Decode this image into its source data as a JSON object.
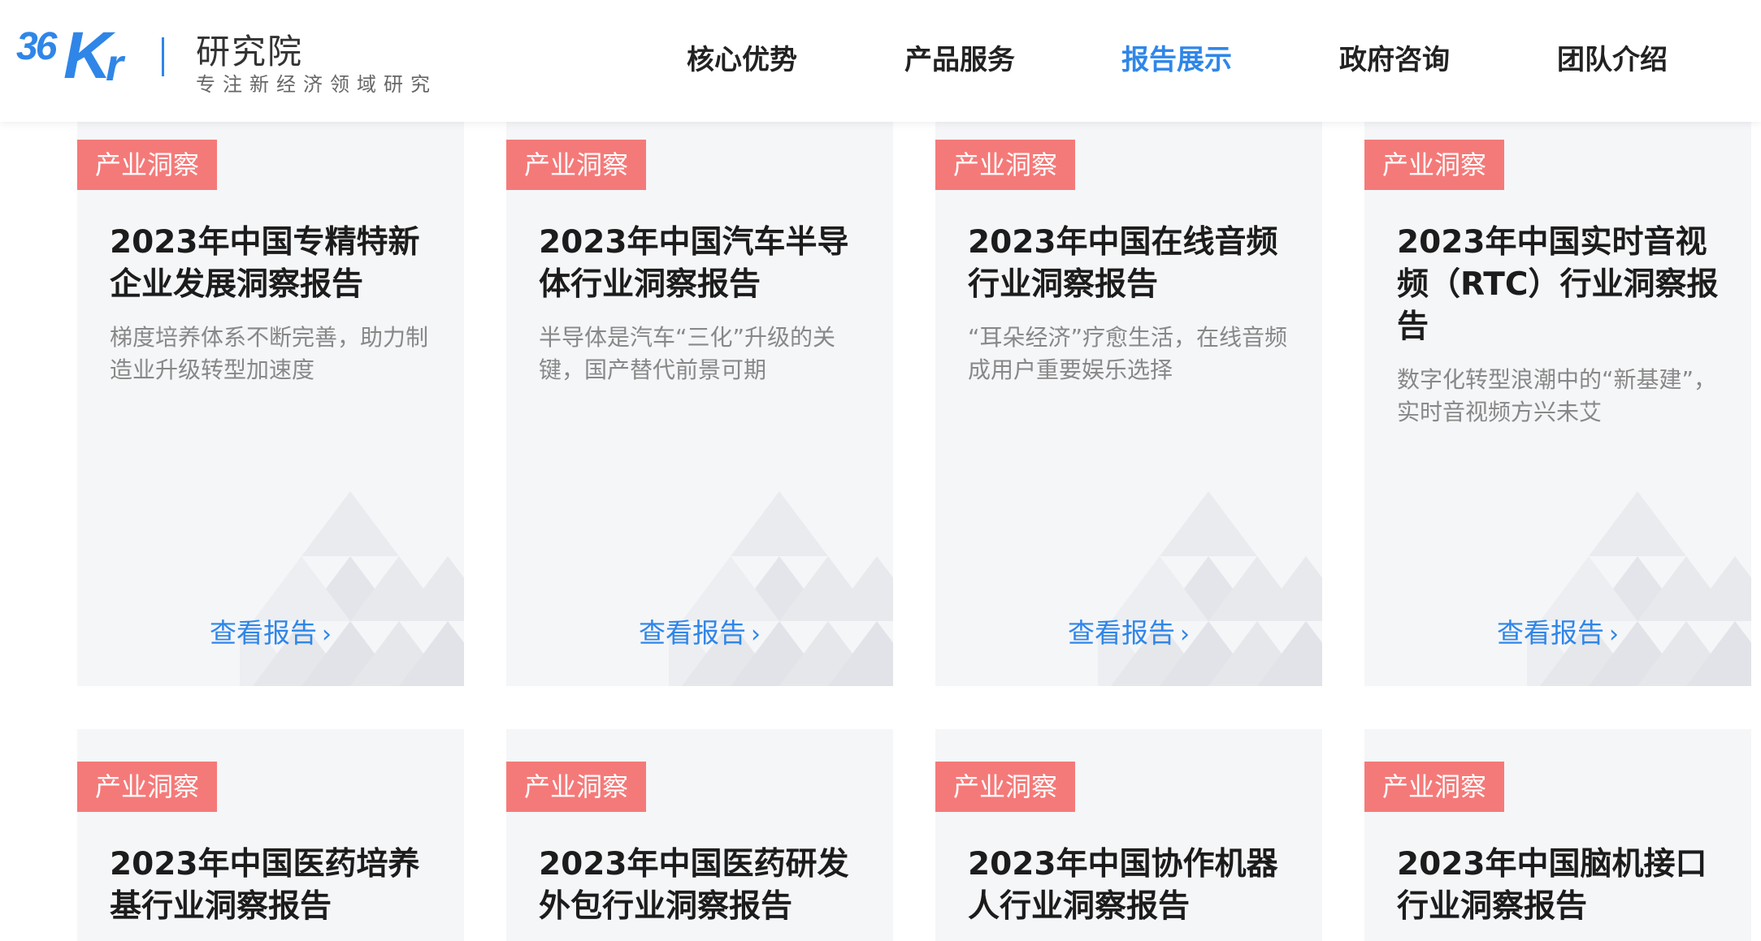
{
  "brand": {
    "logo_text_36": "36",
    "logo_text_k": "K",
    "logo_text_r": "r",
    "name": "研究院",
    "tagline": "专注新经济领域研究"
  },
  "nav": {
    "items": [
      "核心优势",
      "产品服务",
      "报告展示",
      "政府咨询",
      "团队介绍"
    ],
    "active_index": 2
  },
  "cards": [
    {
      "tag": "产业洞察",
      "title": "2023年中国专精特新企业发展洞察报告",
      "desc": "梯度培养体系不断完善，助力制造业升级转型加速度",
      "link": "查看报告"
    },
    {
      "tag": "产业洞察",
      "title": "2023年中国汽车半导体行业洞察报告",
      "desc": "半导体是汽车“三化”升级的关键，国产替代前景可期",
      "link": "查看报告"
    },
    {
      "tag": "产业洞察",
      "title": "2023年中国在线音频行业洞察报告",
      "desc": "“耳朵经济”疗愈生活，在线音频成用户重要娱乐选择",
      "link": "查看报告"
    },
    {
      "tag": "产业洞察",
      "title": "2023年中国实时音视频（RTC）行业洞察报告",
      "desc": "数字化转型浪潮中的“新基建”，实时音视频方兴未艾",
      "link": "查看报告"
    },
    {
      "tag": "产业洞察",
      "title": "2023年中国医药培养基行业洞察报告"
    },
    {
      "tag": "产业洞察",
      "title": "2023年中国医药研发外包行业洞察报告"
    },
    {
      "tag": "产业洞察",
      "title": "2023年中国协作机器人行业洞察报告"
    },
    {
      "tag": "产业洞察",
      "title": "2023年中国脑机接口行业洞察报告"
    }
  ],
  "colors": {
    "accent": "#2f86e8",
    "tag_bg": "#f47a79",
    "card_bg": "#f5f6f8",
    "title_text": "#1c1c1c",
    "desc_text": "#888888"
  },
  "icons": {
    "link_chevron": "chevron-right-icon",
    "decoration": "triangle-pattern"
  }
}
